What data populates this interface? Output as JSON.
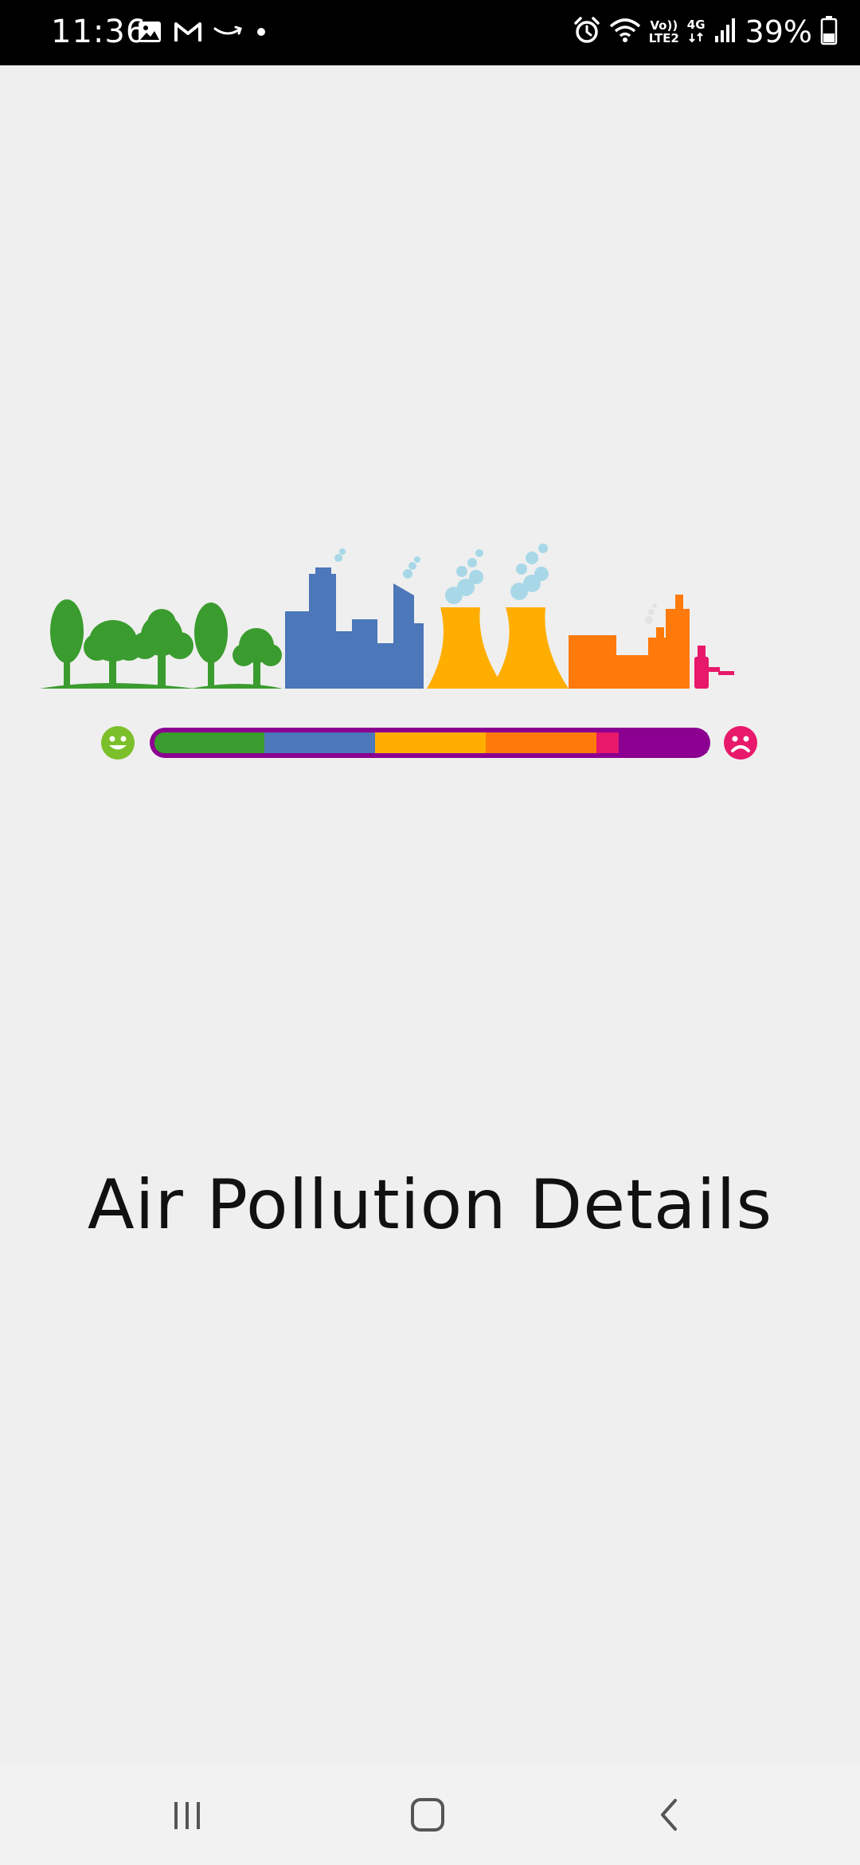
{
  "status_bar": {
    "time": "11:36",
    "battery_percent": "39%",
    "volte_label": "Vo))",
    "lte_label": "LTE2",
    "network_label": "4G",
    "left_icons": [
      "gallery-icon",
      "gmail-icon",
      "amazon-icon",
      "dot-icon"
    ],
    "right_icons": [
      "alarm-icon",
      "wifi-icon",
      "volte-icon",
      "network-4g-icon",
      "signal-icon",
      "battery-icon"
    ]
  },
  "main": {
    "title": "Air Pollution Details",
    "scale": {
      "good_icon": "smiley-face-icon",
      "bad_icon": "sad-face-icon",
      "segments": [
        {
          "name": "good",
          "color": "#3a9c2e"
        },
        {
          "name": "moderate",
          "color": "#4c77b8"
        },
        {
          "name": "unhealthy-sensitive",
          "color": "#ffae00"
        },
        {
          "name": "unhealthy",
          "color": "#ff7a0a"
        },
        {
          "name": "very-unhealthy",
          "color": "#e8186a"
        },
        {
          "name": "hazardous",
          "color": "#8b0090"
        }
      ]
    },
    "illustration_sections": [
      "trees",
      "city-buildings",
      "cooling-towers",
      "factory",
      "chemical-bottle"
    ]
  },
  "navigation": {
    "recent_icon": "recent-apps-icon",
    "home_icon": "home-icon",
    "back_icon": "back-icon"
  }
}
